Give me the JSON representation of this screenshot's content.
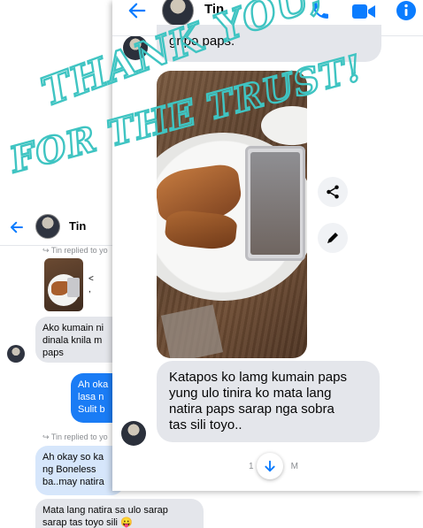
{
  "overlay": {
    "line1": "THANK YOU,",
    "line2": "FOR THE TRUST!"
  },
  "back_chat": {
    "header": {
      "name": "Tin"
    },
    "reply_note_1": "Tin replied to yo",
    "reply_note_2": "Tin replied to yo",
    "thumb_caption_1": "<",
    "thumb_caption_2": ",",
    "incoming_1": [
      "Ako kumain ni",
      "dinala knila m",
      "paps"
    ],
    "outgoing_1": [
      "Ah oka",
      "lasa n",
      "Sulit b"
    ],
    "reply_quote": [
      "Ah okay so ka",
      "ng Boneless",
      "ba..may natira"
    ],
    "incoming_2": [
      "Mata lang natira sa ulo sarap",
      "sarap tas toyo sili 😛"
    ]
  },
  "chat": {
    "header": {
      "name": "Tin",
      "icons": [
        "back-arrow-icon",
        "phone-icon",
        "video-camera-icon",
        "info-icon"
      ]
    },
    "previous_message": "gripo paps.",
    "photo_alt": "fried fish with soy sauce and chili",
    "actions": [
      "share-icon",
      "edit-pencil-icon"
    ],
    "message": "Katapos ko lamg kumain paps\nyung ulo tinira ko mata lang\nnatira paps sarap nga sobra\ntas sili toyo..",
    "timestamp_left": "1",
    "timestamp_right": "M"
  },
  "colors": {
    "accent": "#0a7cff",
    "bubble_in": "#e4e6eb",
    "bubble_out": "#1a7cf5",
    "overlay": "#3fc4c2"
  }
}
